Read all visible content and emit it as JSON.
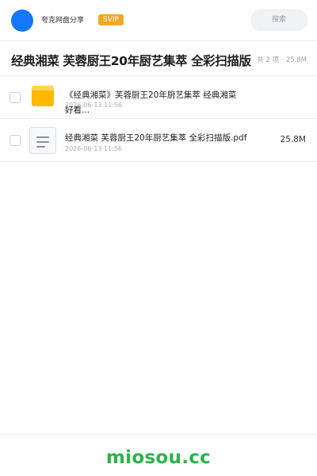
{
  "header": {
    "username": "夸克网盘分享",
    "badge": "SVIP",
    "search_placeholder": "搜索"
  },
  "share": {
    "title": "经典湘菜 芙蓉厨王20年厨艺集萃 全彩扫描版",
    "count": "共 2 项",
    "separator": "·",
    "total_size": "25.8M"
  },
  "files": [
    {
      "name_line1": "《经典湘菜》芙蓉厨王20年厨艺集萃 经典湘菜",
      "name_line2": "好看...",
      "date": "2026-06-13 11:56",
      "icon": "folder-icon",
      "size": ""
    },
    {
      "name_line1": "经典湘菜 芙蓉厨王20年厨艺集萃 全彩扫描版.pdf",
      "date": "2026-06-13 11:56",
      "icon": "document-icon",
      "size": "25.8M"
    }
  ],
  "footer": {
    "brand": "miosou.cc"
  },
  "colors": {
    "accent_blue": "#1677ff",
    "svip_orange": "#f5a623",
    "folder_yellow": "#ffb800",
    "brand_green": "#2bb34a"
  }
}
